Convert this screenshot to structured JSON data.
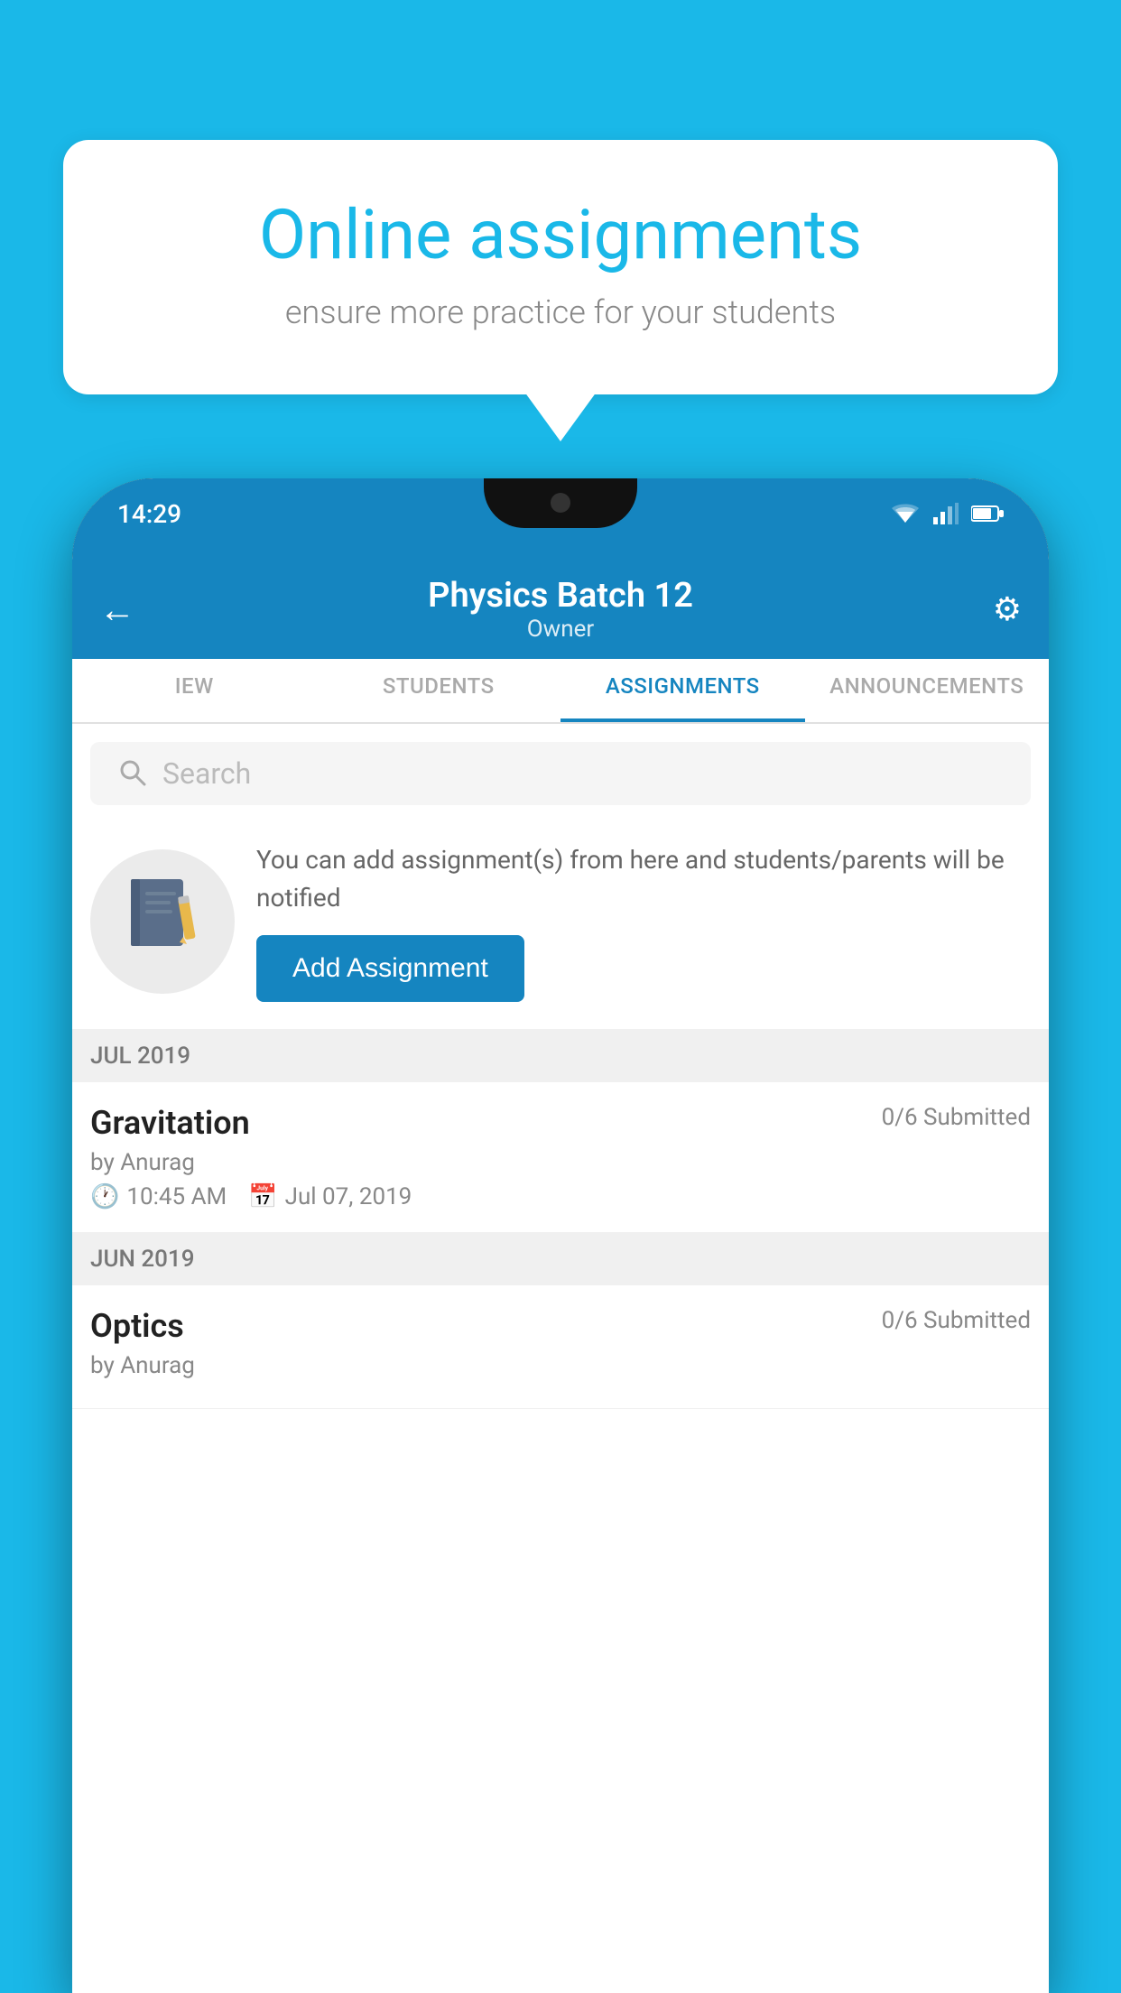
{
  "background_color": "#1ab8e8",
  "speech_bubble": {
    "title": "Online assignments",
    "subtitle": "ensure more practice for your students"
  },
  "status_bar": {
    "time": "14:29"
  },
  "app_bar": {
    "title": "Physics Batch 12",
    "subtitle": "Owner",
    "back_label": "←",
    "settings_label": "⚙"
  },
  "tabs": [
    {
      "label": "IEW",
      "active": false
    },
    {
      "label": "STUDENTS",
      "active": false
    },
    {
      "label": "ASSIGNMENTS",
      "active": true
    },
    {
      "label": "ANNOUNCEMENTS",
      "active": false
    }
  ],
  "search": {
    "placeholder": "Search"
  },
  "add_assignment_section": {
    "description": "You can add assignment(s) from here and students/parents will be notified",
    "button_label": "Add Assignment"
  },
  "sections": [
    {
      "header": "JUL 2019",
      "items": [
        {
          "title": "Gravitation",
          "status": "0/6 Submitted",
          "author": "by Anurag",
          "time": "10:45 AM",
          "date": "Jul 07, 2019"
        }
      ]
    },
    {
      "header": "JUN 2019",
      "items": [
        {
          "title": "Optics",
          "status": "0/6 Submitted",
          "author": "by Anurag",
          "time": "",
          "date": ""
        }
      ]
    }
  ]
}
